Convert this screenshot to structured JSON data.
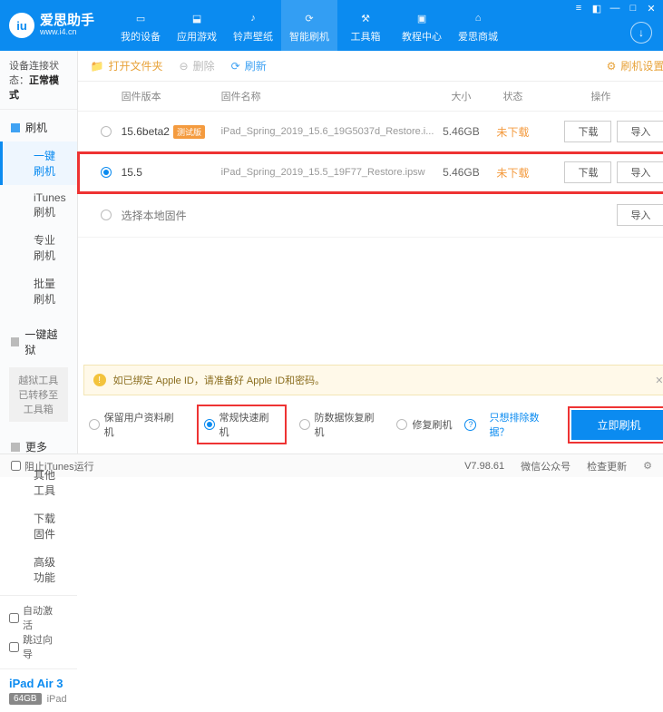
{
  "app": {
    "title": "爱思助手",
    "subtitle": "www.i4.cn"
  },
  "nav": {
    "items": [
      {
        "label": "我的设备"
      },
      {
        "label": "应用游戏"
      },
      {
        "label": "铃声壁纸"
      },
      {
        "label": "智能刷机"
      },
      {
        "label": "工具箱"
      },
      {
        "label": "教程中心"
      },
      {
        "label": "爱思商城"
      }
    ]
  },
  "sidebar": {
    "conn_label": "设备连接状态：",
    "conn_value": "正常模式",
    "flash_head": "刷机",
    "flash_items": [
      "一键刷机",
      "iTunes刷机",
      "专业刷机",
      "批量刷机"
    ],
    "jail_head": "一键越狱",
    "jail_note": "越狱工具已转移至工具箱",
    "more_head": "更多",
    "more_items": [
      "其他工具",
      "下载固件",
      "高级功能"
    ],
    "auto_activate": "自动激活",
    "skip_guide": "跳过向导",
    "device": {
      "name": "iPad Air 3",
      "capacity": "64GB",
      "type": "iPad"
    }
  },
  "toolbar": {
    "open_folder": "打开文件夹",
    "delete": "删除",
    "refresh": "刷新",
    "settings": "刷机设置"
  },
  "table": {
    "h_ver": "固件版本",
    "h_name": "固件名称",
    "h_size": "大小",
    "h_status": "状态",
    "h_ops": "操作",
    "rows": [
      {
        "ver": "15.6beta2",
        "beta": "测试版",
        "name": "iPad_Spring_2019_15.6_19G5037d_Restore.i...",
        "size": "5.46GB",
        "status": "未下载"
      },
      {
        "ver": "15.5",
        "beta": "",
        "name": "iPad_Spring_2019_15.5_19F77_Restore.ipsw",
        "size": "5.46GB",
        "status": "未下载"
      }
    ],
    "btn_download": "下载",
    "btn_import": "导入",
    "local_label": "选择本地固件"
  },
  "notice": {
    "text": "如已绑定 Apple ID，请准备好 Apple ID和密码。"
  },
  "modes": {
    "keep": "保留用户资料刷机",
    "normal": "常规快速刷机",
    "dfu": "防数据恢复刷机",
    "repair": "修复刷机",
    "exclude_link": "只想排除数据？",
    "flash_btn": "立即刷机"
  },
  "status": {
    "block_itunes": "阻止iTunes运行",
    "version": "V7.98.61",
    "wechat": "微信公众号",
    "check_update": "检查更新"
  }
}
